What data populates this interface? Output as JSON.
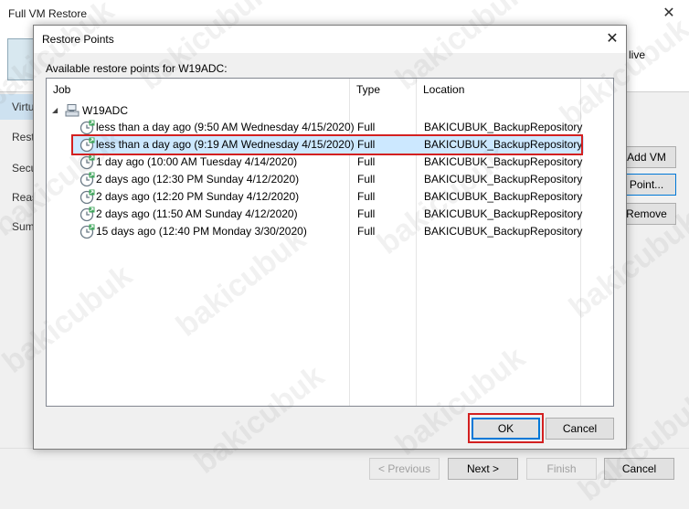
{
  "background_window": {
    "title": "Full VM Restore",
    "header_text": "live",
    "nav_items": [
      "Virtu",
      "Resto",
      "Secu",
      "Reas",
      "Sum"
    ],
    "buttons": {
      "add_vm": "Add VM",
      "point": "Point...",
      "remove": "Remove",
      "previous": "< Previous",
      "next": "Next >",
      "finish": "Finish",
      "cancel": "Cancel"
    }
  },
  "dialog": {
    "title": "Restore Points",
    "label": "Available restore points for W19ADC:",
    "columns": {
      "job": "Job",
      "type": "Type",
      "location": "Location"
    },
    "root": "W19ADC",
    "rows": [
      {
        "job": "less than a day ago (9:50 AM Wednesday 4/15/2020)",
        "type": "Full",
        "location": "BAKICUBUK_BackupRepository",
        "selected": false
      },
      {
        "job": "less than a day ago (9:19 AM Wednesday 4/15/2020)",
        "type": "Full",
        "location": "BAKICUBUK_BackupRepository",
        "selected": true
      },
      {
        "job": "1 day ago (10:00 AM Tuesday 4/14/2020)",
        "type": "Full",
        "location": "BAKICUBUK_BackupRepository",
        "selected": false
      },
      {
        "job": "2 days ago (12:30 PM Sunday 4/12/2020)",
        "type": "Full",
        "location": "BAKICUBUK_BackupRepository",
        "selected": false
      },
      {
        "job": "2 days ago (12:20 PM Sunday 4/12/2020)",
        "type": "Full",
        "location": "BAKICUBUK_BackupRepository",
        "selected": false
      },
      {
        "job": "2 days ago (11:50 AM Sunday 4/12/2020)",
        "type": "Full",
        "location": "BAKICUBUK_BackupRepository",
        "selected": false
      },
      {
        "job": "15 days ago (12:40 PM Monday 3/30/2020)",
        "type": "Full",
        "location": "BAKICUBUK_BackupRepository",
        "selected": false
      }
    ],
    "ok_label": "OK",
    "cancel_label": "Cancel"
  },
  "watermark": "bakicubuk",
  "colors": {
    "selection": "#cce8ff",
    "highlight_border": "#d32020",
    "accent": "#0078d7"
  }
}
